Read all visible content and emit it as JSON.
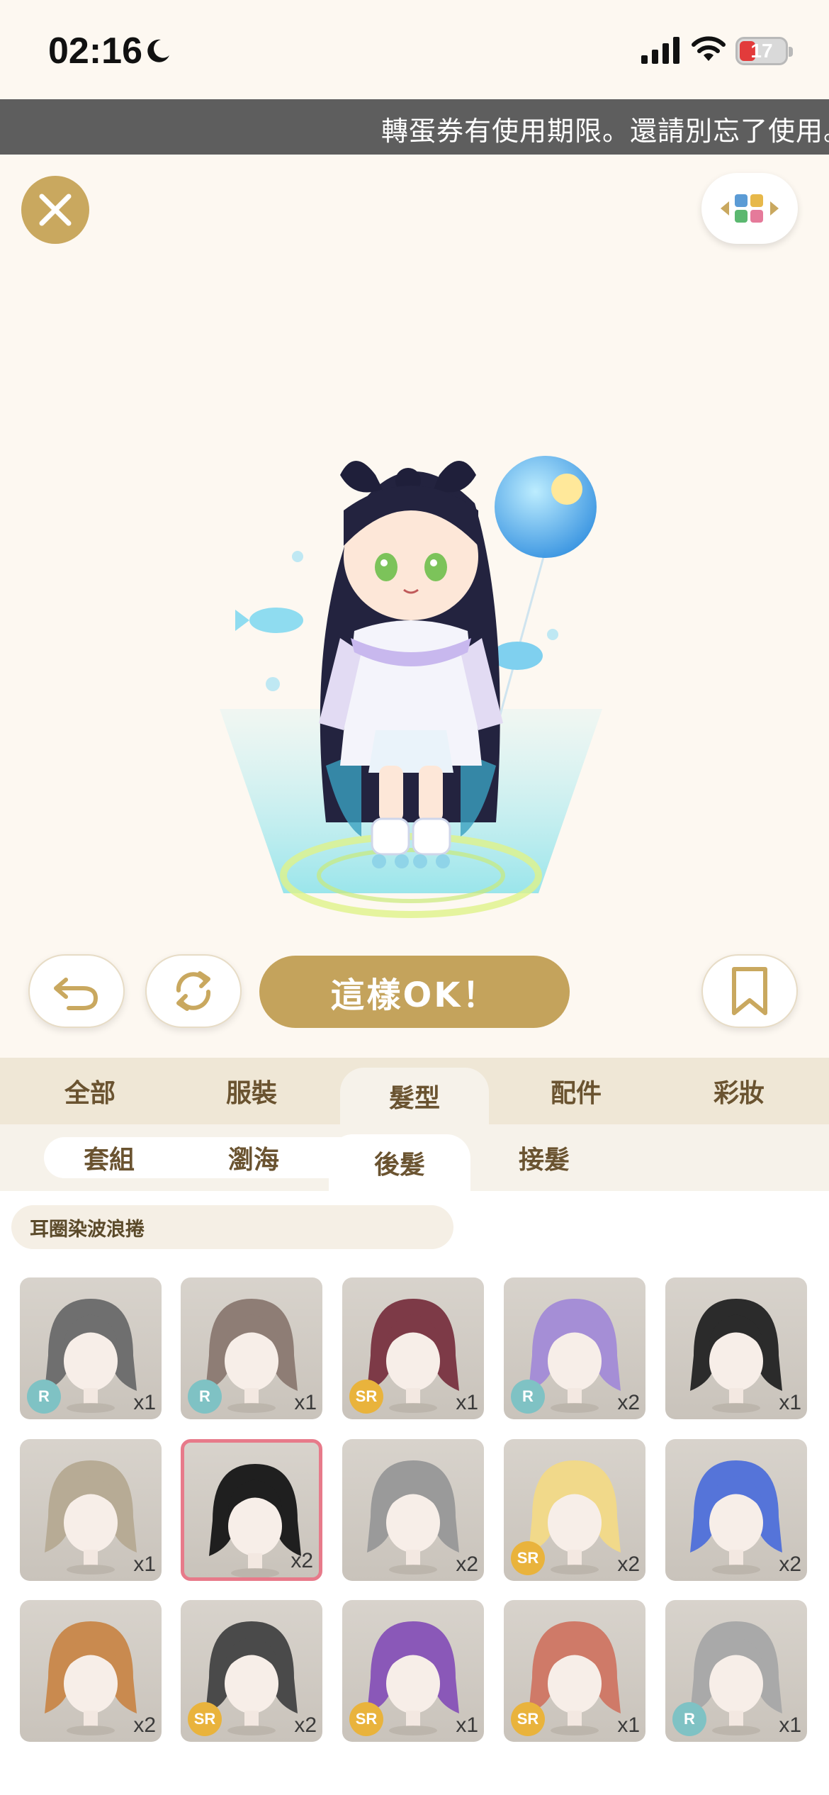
{
  "status": {
    "time": "02:16",
    "battery": "17"
  },
  "banner": {
    "text": "轉蛋券有使用期限。還請別忘了使用。"
  },
  "buttons": {
    "ok_label": "這樣OK！"
  },
  "main_tabs": [
    {
      "label": "全部"
    },
    {
      "label": "服裝"
    },
    {
      "label": "髮型",
      "active": true
    },
    {
      "label": "配件"
    },
    {
      "label": "彩妝"
    }
  ],
  "sub_tabs": [
    {
      "label": "套組"
    },
    {
      "label": "瀏海"
    },
    {
      "label": "後髮",
      "active": true
    },
    {
      "label": "接髮"
    }
  ],
  "filter": {
    "label": "耳圈染波浪捲"
  },
  "items": [
    {
      "hair": "#6f6f6f",
      "rarity": "R",
      "qty": "x1"
    },
    {
      "hair": "#8e7d75",
      "rarity": "R",
      "qty": "x1"
    },
    {
      "hair": "#7d3a47",
      "rarity": "SR",
      "qty": "x1"
    },
    {
      "hair": "#a58ed6",
      "rarity": "R",
      "qty": "x2"
    },
    {
      "hair": "#2b2b2b",
      "rarity": "",
      "qty": "x1"
    },
    {
      "hair": "#b7ab95",
      "rarity": "",
      "qty": "x1"
    },
    {
      "hair": "#1f1f1f",
      "rarity": "",
      "qty": "x2",
      "selected": true
    },
    {
      "hair": "#9a9a9a",
      "rarity": "",
      "qty": "x2"
    },
    {
      "hair": "#f1d98a",
      "rarity": "SR",
      "qty": "x2"
    },
    {
      "hair": "#5574d9",
      "rarity": "",
      "qty": "x2"
    },
    {
      "hair": "#c98a4f",
      "rarity": "",
      "qty": "x2"
    },
    {
      "hair": "#4a4a4a",
      "rarity": "SR",
      "qty": "x2"
    },
    {
      "hair": "#8a58b8",
      "rarity": "SR",
      "qty": "x1"
    },
    {
      "hair": "#cf7a68",
      "rarity": "SR",
      "qty": "x1"
    },
    {
      "hair": "#a9a9a9",
      "rarity": "R",
      "qty": "x1"
    }
  ],
  "colors": {
    "accent": "#c4a35c",
    "selected_border": "#e77a8a",
    "rarity_R": "#7fc2c4",
    "rarity_SR": "#e9b33c"
  }
}
